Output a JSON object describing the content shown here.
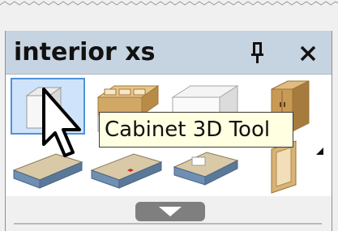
{
  "panel": {
    "title": "interior xs",
    "pin_icon": "pin-icon",
    "close_icon": "close-icon",
    "pin_glyph": "ᵖ",
    "close_glyph": "✕"
  },
  "tools": [
    {
      "icon": "cabinet-3d-icon",
      "selected": true
    },
    {
      "icon": "drawer-cabinet-icon",
      "selected": false
    },
    {
      "icon": "base-cabinet-icon",
      "selected": false
    },
    {
      "icon": "tall-cabinet-icon",
      "selected": false
    },
    {
      "icon": "countertop-icon",
      "selected": false
    },
    {
      "icon": "countertop-sink-icon",
      "selected": false
    },
    {
      "icon": "countertop-corner-icon",
      "selected": false
    },
    {
      "icon": "cabinet-door-icon",
      "selected": false
    }
  ],
  "tooltip": {
    "text": "Cabinet 3D Tool"
  },
  "bottom": {
    "expand_icon": "expand-down-icon"
  },
  "colors": {
    "titlebar": "#c6d3e1",
    "selection": "#4f92d8",
    "tooltip_bg": "#ffffe1",
    "wood": "#d2a867",
    "countertop": "#6f8fb3"
  }
}
